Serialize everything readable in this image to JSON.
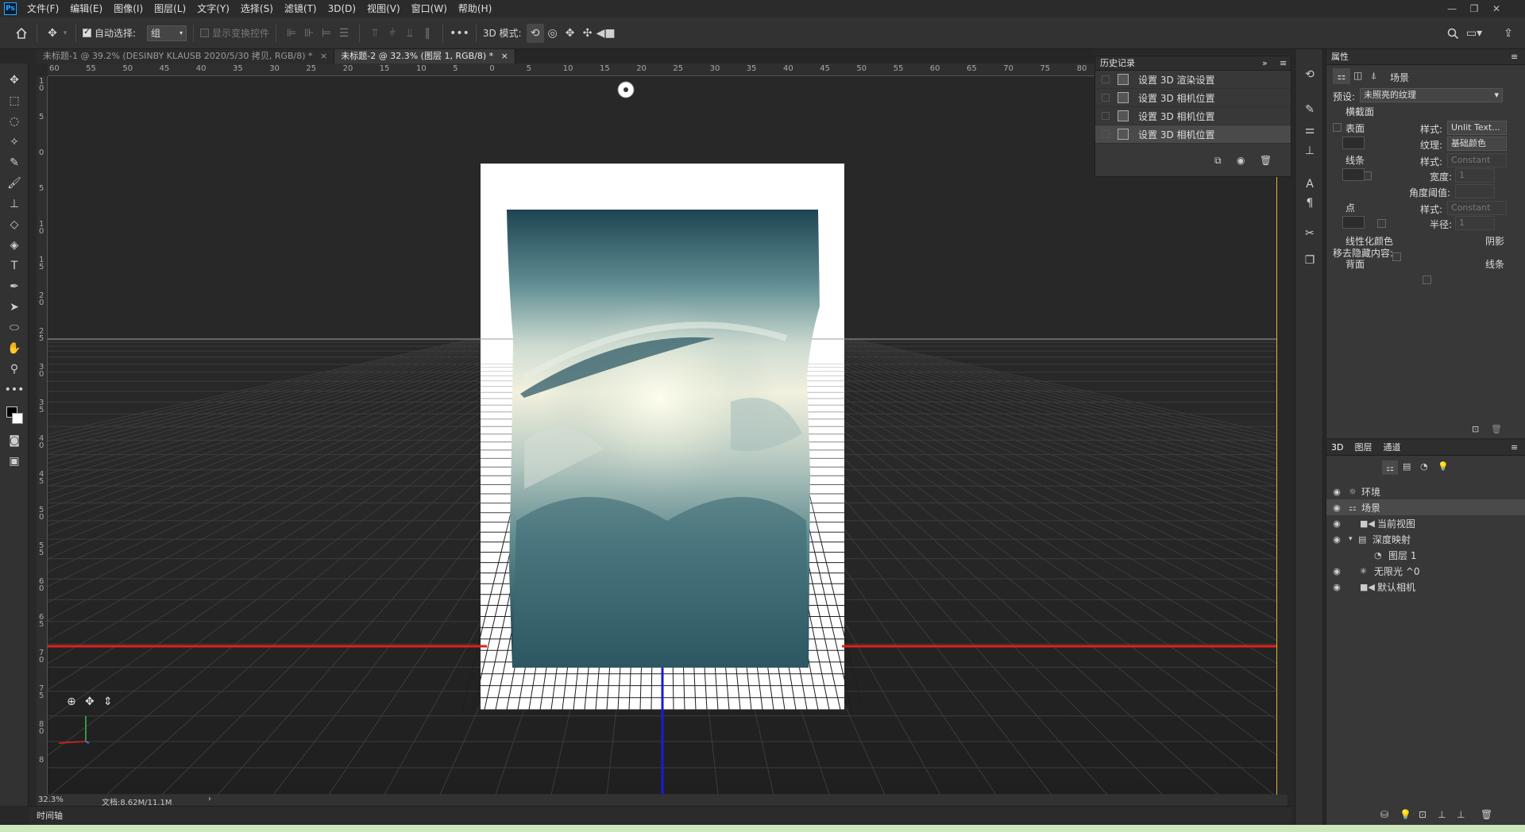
{
  "app": {
    "logo": "Ps"
  },
  "menu": [
    "文件(F)",
    "编辑(E)",
    "图像(I)",
    "图层(L)",
    "文字(Y)",
    "选择(S)",
    "滤镜(T)",
    "3D(D)",
    "视图(V)",
    "窗口(W)",
    "帮助(H)"
  ],
  "options_bar": {
    "auto_select_label": "自动选择:",
    "auto_select_value": "组",
    "show_transform_label": "显示变换控件",
    "mode_label": "3D 模式:",
    "more_label": "•••"
  },
  "tabs": [
    {
      "label": "未标题-1 @ 39.2% (DESINBY KLAUSB    2020/5/30 拷贝, RGB/8) *",
      "close": "×"
    },
    {
      "label": "未标题-2 @ 32.3% (图层 1, RGB/8) *",
      "close": "×"
    }
  ],
  "ruler_h": [
    "60",
    "55",
    "50",
    "45",
    "40",
    "35",
    "30",
    "25",
    "20",
    "15",
    "10",
    "5",
    "0",
    "5",
    "10",
    "15",
    "20",
    "25",
    "30",
    "35",
    "40",
    "45",
    "50",
    "55",
    "60",
    "65",
    "70",
    "75",
    "80"
  ],
  "ruler_v": [
    "1 0",
    "5",
    "0",
    "5",
    "1 0",
    "1 5",
    "2 0",
    "2 5",
    "3 0",
    "3 5",
    "4 0",
    "4 5",
    "5 0",
    "5 5",
    "6 0",
    "6 5",
    "7 0",
    "7 5",
    "8 0",
    "8"
  ],
  "history": {
    "title": "历史记录",
    "items": [
      "设置 3D 渲染设置",
      "设置 3D 相机位置",
      "设置 3D 相机位置",
      "设置 3D 相机位置"
    ]
  },
  "properties": {
    "title": "属性",
    "scene_label": "场景",
    "preset_label": "预设:",
    "preset_value": "未照亮的纹理",
    "cross_section": "横截面",
    "surface": "表面",
    "style_label": "样式:",
    "surface_style": "Unlit Text...",
    "texture_label": "纹理:",
    "texture_value": "基础颜色",
    "lines": "线条",
    "lines_style": "Constant",
    "width_label": "宽度:",
    "width_value": "1",
    "angle_label": "角度阈值:",
    "points": "点",
    "points_style": "Constant",
    "radius_label": "半径:",
    "radius_value": "1",
    "linearize": "线性化颜色",
    "shadow": "阴影",
    "remove_hidden": "移去隐藏内容:",
    "backface": "背面",
    "lines_check": "线条"
  },
  "panel3d": {
    "tabs": [
      "3D",
      "图层",
      "通道"
    ],
    "items": [
      {
        "label": "环境",
        "icon": "environment-icon"
      },
      {
        "label": "场景",
        "icon": "scene-icon"
      },
      {
        "label": "当前视图",
        "icon": "camera-icon"
      },
      {
        "label": "深度映射",
        "icon": "mesh-icon"
      },
      {
        "label": "图层 1",
        "icon": "material-icon"
      },
      {
        "label": "无限光 ^0",
        "icon": "light-icon"
      },
      {
        "label": "默认相机",
        "icon": "camera-icon"
      }
    ]
  },
  "status": {
    "zoom": "32.3%",
    "doc": "文档:8.62M/11.1M",
    "arrow": "›"
  },
  "timeline": {
    "label": "时间轴"
  },
  "colors": {
    "accent": "#e0b63a",
    "x_axis": "#e0201c",
    "z_axis": "#1a1ad8",
    "grid": "#ffffff"
  }
}
